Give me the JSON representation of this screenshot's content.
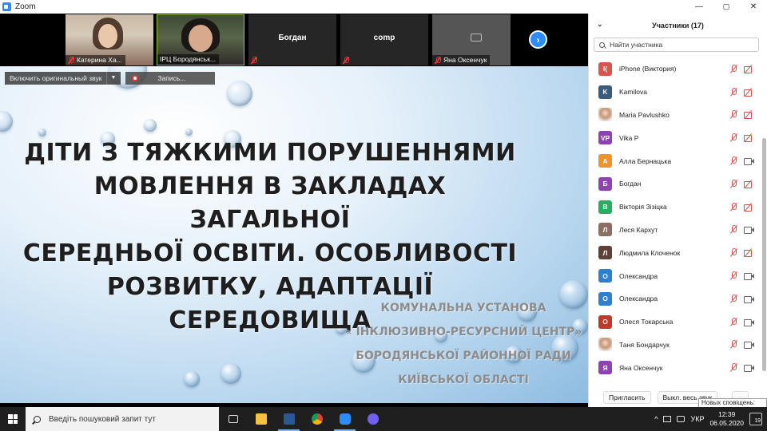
{
  "window": {
    "title": "Zoom",
    "controls": {
      "minimize": "—",
      "maximize": "▢",
      "close": "✕"
    }
  },
  "thumbnails": [
    {
      "name": "Катерина Ха...",
      "muted": true,
      "type": "video"
    },
    {
      "name": "ІРЦ Бородянськ...",
      "muted": false,
      "type": "video"
    },
    {
      "center_name": "Богдан",
      "muted": true,
      "type": "name"
    },
    {
      "center_name": "comp",
      "muted": true,
      "type": "name"
    },
    {
      "name": "Яна Оксенчук",
      "muted": true,
      "type": "camoff"
    }
  ],
  "toolbar": {
    "original_sound": "Включить оригинальный звук",
    "record": "Запись..."
  },
  "slide": {
    "title_lines": [
      "ДІТИ З ТЯЖКИМИ ПОРУШЕННЯМИ",
      "МОВЛЕННЯ  В ЗАКЛАДАХ ЗАГАЛЬНОЇ",
      "СЕРЕДНЬОЇ ОСВІТИ. ОСОБЛИВОСТІ",
      "РОЗВИТКУ, АДАПТАЦІЇ СЕРЕДОВИЩА"
    ],
    "org_lines": [
      "КОМУНАЛЬНА УСТАНОВА",
      "« ІНКЛЮЗИВНО-РЕСУРСНИЙ ЦЕНТР»",
      "БОРОДЯНСЬКОЇ РАЙОННОЇ РАДИ",
      "КИЇВСЬКОЇ ОБЛАСТІ"
    ]
  },
  "panel": {
    "title": "Участники (17)",
    "search_placeholder": "Найти участника",
    "participants": [
      {
        "initial": "I(",
        "name": "iPhone (Виктория)",
        "color": "#d9534f",
        "cam": "off"
      },
      {
        "initial": "K",
        "name": "Kamilova",
        "color": "#3a5a80",
        "cam": "off"
      },
      {
        "initial": "",
        "name": "Maria Pavlushko",
        "color": "photo",
        "cam": "off"
      },
      {
        "initial": "VP",
        "name": "Vika P",
        "color": "#8e44ad",
        "cam": "off"
      },
      {
        "initial": "А",
        "name": "Алла Бернацька",
        "color": "#f0932b",
        "cam": "on"
      },
      {
        "initial": "Б",
        "name": "Богдан",
        "color": "#8e44ad",
        "cam": "off"
      },
      {
        "initial": "В",
        "name": "Вікторія Зізіцка",
        "color": "#27ae60",
        "cam": "off"
      },
      {
        "initial": "Л",
        "name": "Леся Кархут",
        "color": "#8d6e63",
        "cam": "on"
      },
      {
        "initial": "Л",
        "name": "Людмила Клоченок",
        "color": "#5d4037",
        "cam": "off"
      },
      {
        "initial": "О",
        "name": "Олександра",
        "color": "#2d7fcf",
        "cam": "on"
      },
      {
        "initial": "О",
        "name": "Олександра",
        "color": "#2d7fcf",
        "cam": "on"
      },
      {
        "initial": "О",
        "name": "Олеся Токарська",
        "color": "#c0392b",
        "cam": "on"
      },
      {
        "initial": "",
        "name": "Таня Бондарчук",
        "color": "photo",
        "cam": "on"
      },
      {
        "initial": "Я",
        "name": "Яна Оксенчук",
        "color": "#8e44ad",
        "cam": "on"
      }
    ],
    "invite": "Пригласить",
    "mute_all": "Выкл. весь звук",
    "more": "...",
    "notifications": "Новых сповіщень: 19"
  },
  "taskbar": {
    "search_placeholder": "Введіть пошуковий запит тут",
    "lang": "УКР",
    "time": "12:39",
    "date": "06.05.2020",
    "badge": "19",
    "tray_arrow": "^"
  }
}
